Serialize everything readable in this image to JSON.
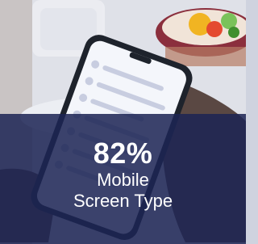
{
  "stat": {
    "value": "82%",
    "line1": "Mobile",
    "line2": "Screen Type"
  },
  "colors": {
    "overlay": "#1c2454",
    "text": "#ffffff"
  }
}
